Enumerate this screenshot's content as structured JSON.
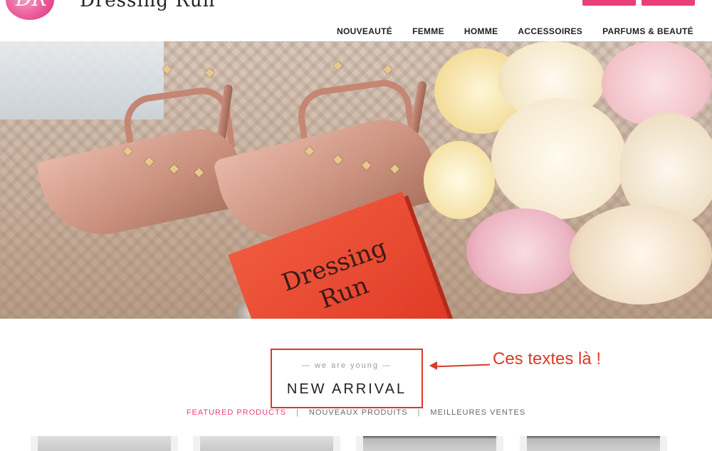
{
  "header": {
    "brand_name": "Dressing Run",
    "logo_text": "DR"
  },
  "nav": {
    "items": [
      "NOUVEAUTÉ",
      "FEMME",
      "HOMME",
      "ACCESSOIRES",
      "PARFUMS & BEAUTÉ"
    ]
  },
  "hero": {
    "book_text": "Dressing Run"
  },
  "section": {
    "tagline": "— we are young —",
    "title": "NEW ARRIVAL",
    "annotation": "Ces textes là !"
  },
  "tabs": {
    "items": [
      "FEATURED PRODUCTS",
      "NOUVEAUX PRODUITS",
      "MEILLEURES VENTES"
    ],
    "active_index": 0
  },
  "colors": {
    "accent": "#e93f7a",
    "annotation_red": "#d93a26"
  }
}
